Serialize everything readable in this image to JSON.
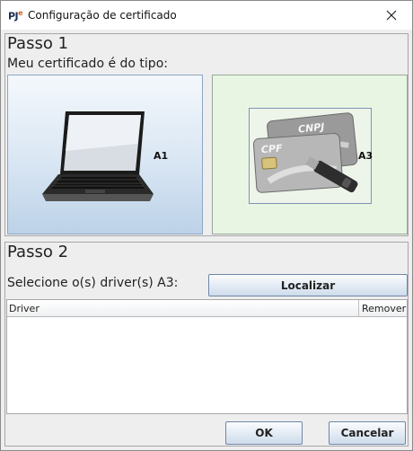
{
  "window": {
    "app_icon_text": "PJ",
    "app_icon_sup": "e",
    "title": "Configuração de certificado",
    "close_glyph": "✕"
  },
  "step1": {
    "title": "Passo 1",
    "subtitle": "Meu certificado é do tipo:",
    "options": [
      {
        "label": "A1",
        "icon": "laptop-icon",
        "selected": false
      },
      {
        "label": "A3",
        "icon": "smartcard-token-icon",
        "selected": true
      }
    ],
    "card_labels": [
      "CNPJ",
      "CPF"
    ]
  },
  "step2": {
    "title": "Passo 2",
    "driver_prompt": "Selecione o(s) driver(s) A3:",
    "locate_button": "Localizar",
    "table": {
      "columns": [
        "Driver",
        "Remover"
      ],
      "rows": []
    }
  },
  "footer": {
    "ok_label": "OK",
    "cancel_label": "Cancelar"
  },
  "colors": {
    "selected_option_bg": "#e9f5e3",
    "button_border": "#6f86a6",
    "pje_orange": "#d6611d",
    "pje_navy": "#1d2f57"
  }
}
